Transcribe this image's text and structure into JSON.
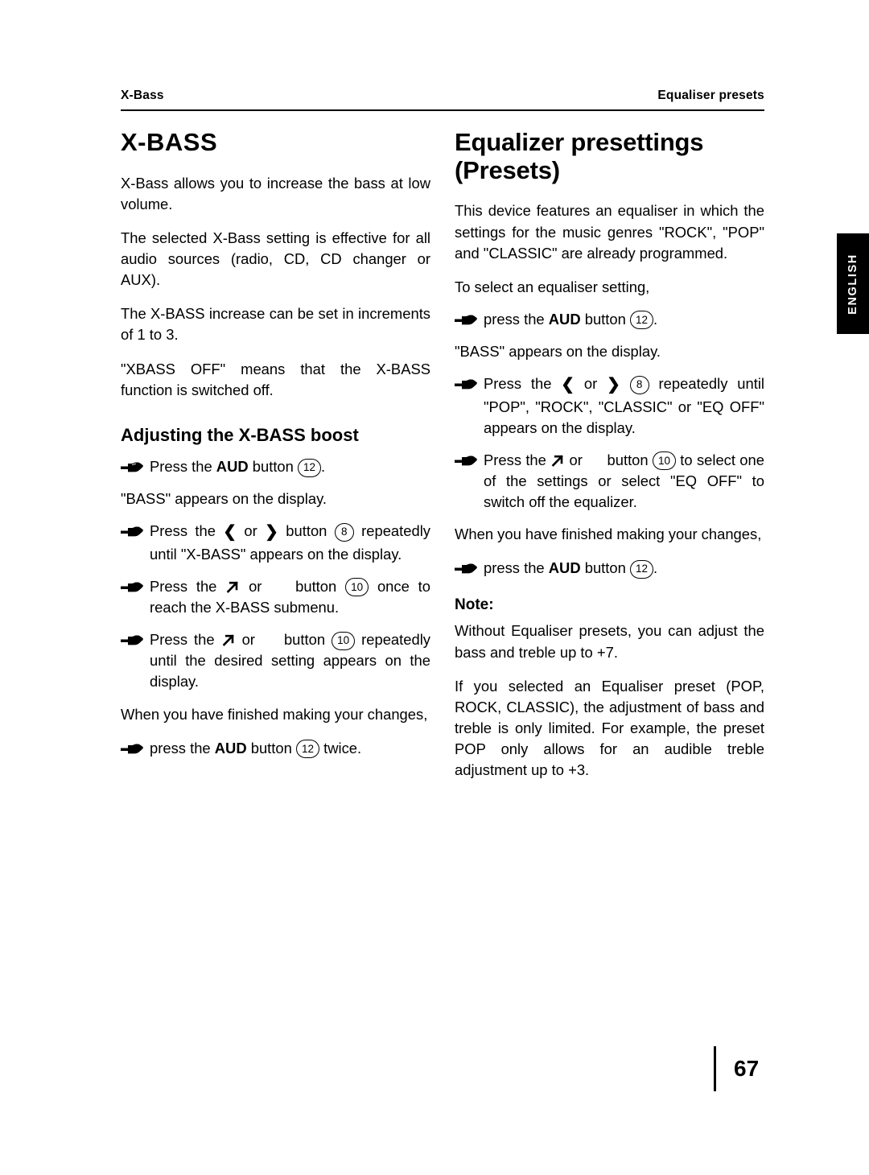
{
  "header": {
    "left": "X-Bass",
    "right": "Equaliser presets"
  },
  "side_tab": {
    "label": "ENGLISH"
  },
  "footer": {
    "page_number": "67"
  },
  "left_column": {
    "title": "X-BASS",
    "p1": "X-Bass allows you to increase the bass at low volume.",
    "p2": "The selected X-Bass setting is effective for all audio sources (radio, CD, CD changer or AUX).",
    "p3": "The X-BASS increase can be set in increments of 1 to 3.",
    "p4": "\"XBASS OFF\" means that the X-BASS function is switched off.",
    "subtitle": "Adjusting the X-BASS boost",
    "step1_a": "Press the ",
    "step1_b": "AUD",
    "step1_c": " button ",
    "step1_num": "12",
    "step1_d": ".",
    "note1": "\"BASS\" appears on the display.",
    "step2_a": "Press the ",
    "step2_or": " or ",
    "step2_b": " button ",
    "step2_num": "8",
    "step2_c": " repeatedly until \"X-BASS\" appears on the display.",
    "step3_a": "Press the ",
    "step3_or": " or ",
    "step3_b": " button ",
    "step3_num": "10",
    "step3_c": " once to reach the X-BASS submenu.",
    "step4_a": "Press the ",
    "step4_or": " or ",
    "step4_b": " button ",
    "step4_num": "10",
    "step4_c": " repeatedly until the desired setting appears on the display.",
    "p5": "When you have finished making your changes,",
    "step5_a": "press the ",
    "step5_b": "AUD",
    "step5_c": " button ",
    "step5_num": "12",
    "step5_d": " twice."
  },
  "right_column": {
    "title_line1": "Equalizer presettings",
    "title_line2": "(Presets)",
    "p1": "This device features an equaliser in which the settings for the music genres \"ROCK\", \"POP\" and \"CLASSIC\" are already programmed.",
    "p2": "To select an equaliser setting,",
    "step1_a": "press the ",
    "step1_b": "AUD",
    "step1_c": " button ",
    "step1_num": "12",
    "step1_d": ".",
    "note1": "\"BASS\" appears on the display.",
    "step2_a": "Press the ",
    "step2_or": " or ",
    "step2_num": "8",
    "step2_c": " repeatedly until \"POP\", \"ROCK\", \"CLASSIC\" or \"EQ OFF\" appears on the display.",
    "step3_a": "Press the ",
    "step3_or": " or ",
    "step3_b": " button ",
    "step3_num": "10",
    "step3_c": " to select one of the settings or select \"EQ OFF\" to switch off the equalizer.",
    "p3": "When you have finished making your changes,",
    "step4_a": "press the ",
    "step4_b": "AUD",
    "step4_c": " button ",
    "step4_num": "12",
    "step4_d": ".",
    "note_heading": "Note:",
    "note_p1": "Without Equaliser presets, you can adjust the bass and treble up to +7.",
    "note_p2": "If you selected an Equaliser preset (POP, ROCK, CLASSIC), the adjustment of bass and treble is only limited. For example, the preset POP only allows for an audible treble adjustment up to +3."
  }
}
